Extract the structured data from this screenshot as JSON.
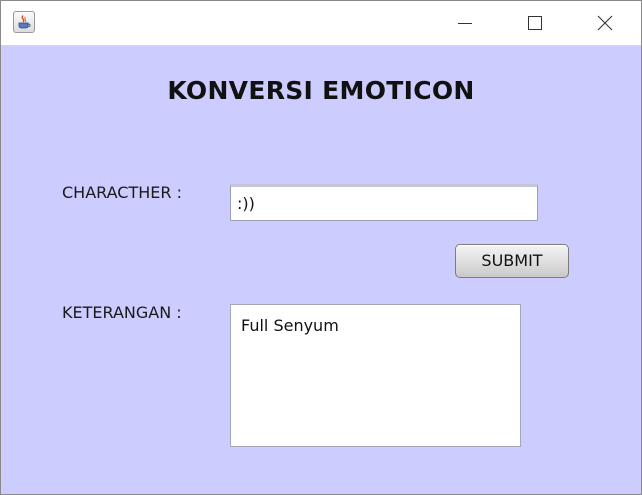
{
  "window": {
    "icon": "java-cup-icon",
    "controls": {
      "minimize": "minimize-icon",
      "maximize": "maximize-icon",
      "close": "close-icon"
    }
  },
  "form": {
    "title": "KONVERSI EMOTICON",
    "char_label": "CHARACTHER :",
    "char_value": ":))",
    "submit_label": "SUBMIT",
    "result_label": "KETERANGAN :",
    "result_value": "Full Senyum"
  },
  "colors": {
    "background": "#ccccff",
    "titlebar": "#ffffff",
    "field": "#ffffff"
  }
}
